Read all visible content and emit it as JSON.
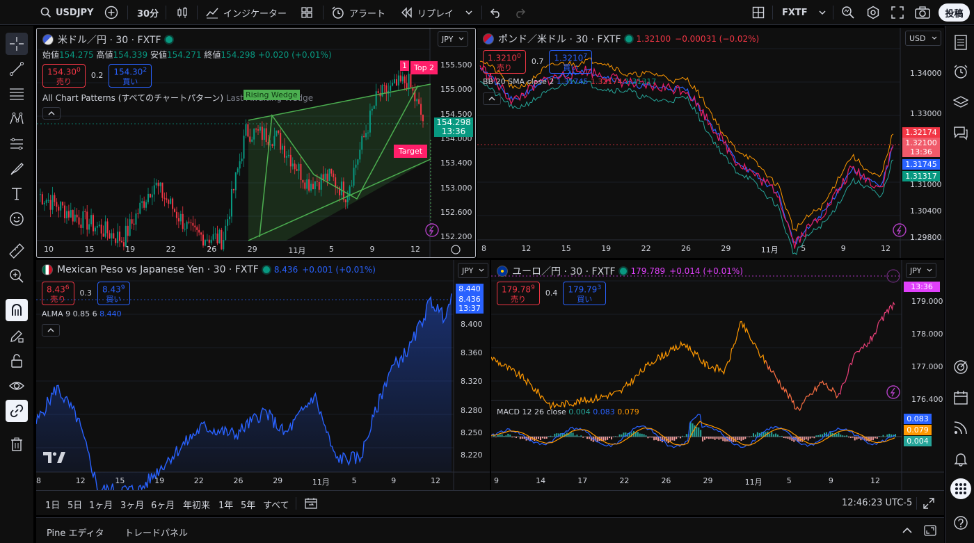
{
  "toolbar": {
    "symbol": "USDJPY",
    "interval": "30分",
    "indicators_label": "インジケーター",
    "alert_label": "アラート",
    "replay_label": "リプレイ",
    "broker": "FXTF",
    "post_label": "投稿"
  },
  "panes": {
    "usdjpy": {
      "title": "米ドル／円 · 30 · FXTF",
      "currency": "JPY",
      "ohlc": {
        "open_k": "始値",
        "open": "154.275",
        "high_k": "高値",
        "high": "154.339",
        "low_k": "安値",
        "low": "154.271",
        "close_k": "終値",
        "close": "154.298",
        "change": "+0.020 (+0.01%)"
      },
      "sell_price": "154.30",
      "sell_sup": "0",
      "sell_label": "売り",
      "spread": "0.2",
      "buy_price": "154.30",
      "buy_sup": "2",
      "buy_label": "買い",
      "indicator": "All Chart Patterns (すべてのチャートパターン)",
      "indicator_extra": "Last Awaiting Wedge",
      "pattern_label": "Rising Wedge",
      "top_label": "Top 2",
      "top_marker": "1",
      "target_label": "Target",
      "price_tag": "154.298",
      "time_tag": "13:36",
      "y_ticks": [
        "155.500",
        "155.000",
        "154.500",
        "154.000",
        "153.400",
        "153.000",
        "152.600",
        "152.200"
      ],
      "x_ticks": [
        "10",
        "15",
        "19",
        "22",
        "26",
        "29",
        "11月",
        "5",
        "9",
        "12"
      ]
    },
    "gbpusd": {
      "title": "ポンド／米ドル · 30 · FXTF",
      "quote": "1.32100",
      "quote_change": "−0.00031 (−0.02%)",
      "currency": "USD",
      "sell_price": "1.3210",
      "sell_sup": "0",
      "sell_label": "売り",
      "spread": "0.7",
      "buy_price": "1.3210",
      "buy_sup": "7",
      "buy_label": "買い",
      "indicator_name": "BB 20 SMA close 2",
      "bb_basis": "1.31745",
      "bb_upper": "1.32174",
      "bb_lower": "1.31317",
      "price_tag": "1.32100",
      "time_tag": "13:36",
      "y_ticks": [
        "1.34000",
        "1.33000",
        "1.31000",
        "1.30400",
        "1.29800"
      ],
      "x_ticks": [
        "8",
        "12",
        "15",
        "19",
        "22",
        "26",
        "29",
        "11月",
        "5",
        "9",
        "12"
      ]
    },
    "mxnjpy": {
      "title": "Mexican Peso vs Japanese Yen · 30 · FXTF",
      "quote": "8.436",
      "quote_change": "+0.001 (+0.01%)",
      "currency": "JPY",
      "sell_price": "8.43",
      "sell_sup": "6",
      "sell_label": "売り",
      "spread": "0.3",
      "buy_price": "8.43",
      "buy_sup": "9",
      "buy_label": "買い",
      "indicator_name": "ALMA 9 0.85 6",
      "indicator_value": "8.440",
      "alma_tag": "8.440",
      "price_tag": "8.436",
      "time_tag": "13:37",
      "y_ticks": [
        "8.400",
        "8.360",
        "8.320",
        "8.280",
        "8.250",
        "8.220"
      ],
      "x_ticks": [
        "8",
        "12",
        "15",
        "19",
        "22",
        "26",
        "29",
        "11月",
        "5",
        "9",
        "12"
      ]
    },
    "eurjpy": {
      "title": "ユーロ／円 · 30 · FXTF",
      "quote": "179.789",
      "quote_change": "+0.014 (+0.01%)",
      "currency": "JPY",
      "sell_price": "179.78",
      "sell_sup": "9",
      "sell_label": "売り",
      "spread": "0.4",
      "buy_price": "179.79",
      "buy_sup": "3",
      "buy_label": "買い",
      "time_tag": "13:36",
      "y_ticks": [
        "179.000",
        "178.000",
        "177.000",
        "176.400"
      ],
      "macd_name": "MACD 12 26 close",
      "macd_hist": "0.004",
      "macd_line": "0.083",
      "macd_signal": "0.079",
      "x_ticks": [
        "9",
        "14",
        "17",
        "22",
        "26",
        "29",
        "11月",
        "5",
        "9",
        "12"
      ]
    }
  },
  "ranges": [
    "1日",
    "5日",
    "1ヶ月",
    "3ヶ月",
    "6ヶ月",
    "年初来",
    "1年",
    "5年",
    "すべて"
  ],
  "clock": "12:46:23 UTC-5",
  "bottom_tabs": [
    "Pine エディタ",
    "トレードパネル"
  ],
  "colors": {
    "up": "#089981",
    "down": "#f23645",
    "blue": "#2962ff",
    "bg": "#0f0f0f",
    "wedge": "#4caf50",
    "orange": "#ff9800",
    "magenta": "#e040fb",
    "pink": "#ff1f6a"
  }
}
